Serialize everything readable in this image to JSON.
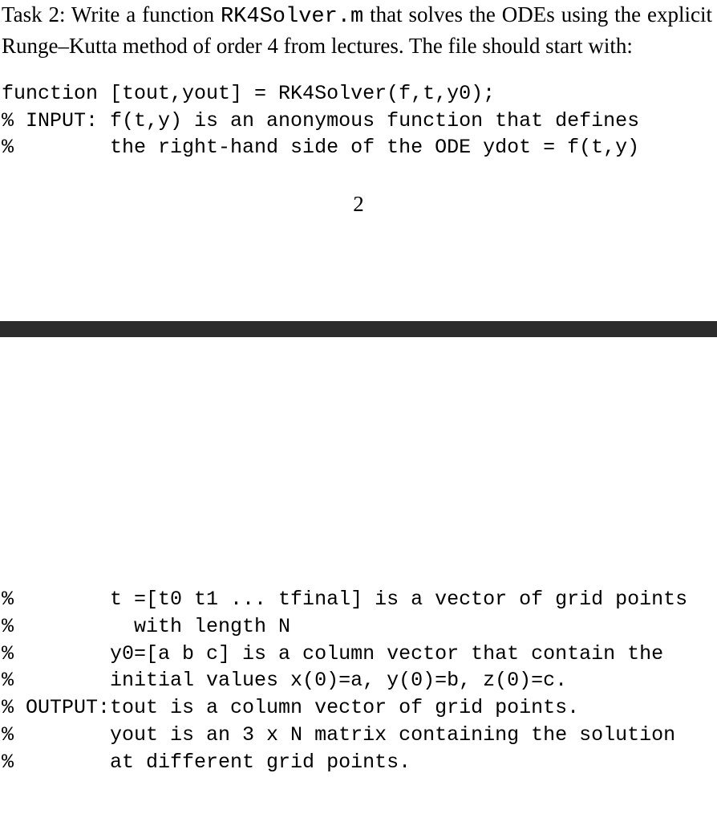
{
  "task": {
    "prefix": "Task 2: Write a function ",
    "filename": "RK4Solver.m",
    "after_filename": " that solves the ODEs using the explicit Runge–Kutta method of order 4 from lectures.  The file should start with:"
  },
  "code_top": {
    "l1": "function [tout,yout] = RK4Solver(f,t,y0);",
    "l2": "% INPUT: f(t,y) is an anonymous function that defines",
    "l3": "%        the right-hand side of the ODE ydot = f(t,y)"
  },
  "page_number": "2",
  "code_bottom": {
    "l1": "%        t =[t0 t1 ... tfinal] is a vector of grid points",
    "l2": "%          with length N",
    "l3": "%        y0=[a b c] is a column vector that contain the",
    "l4": "%        initial values x(0)=a, y(0)=b, z(0)=c.",
    "l5": "% OUTPUT:tout is a column vector of grid points.",
    "l6": "%        yout is an 3 x N matrix containing the solution",
    "l7": "%        at different grid points."
  }
}
